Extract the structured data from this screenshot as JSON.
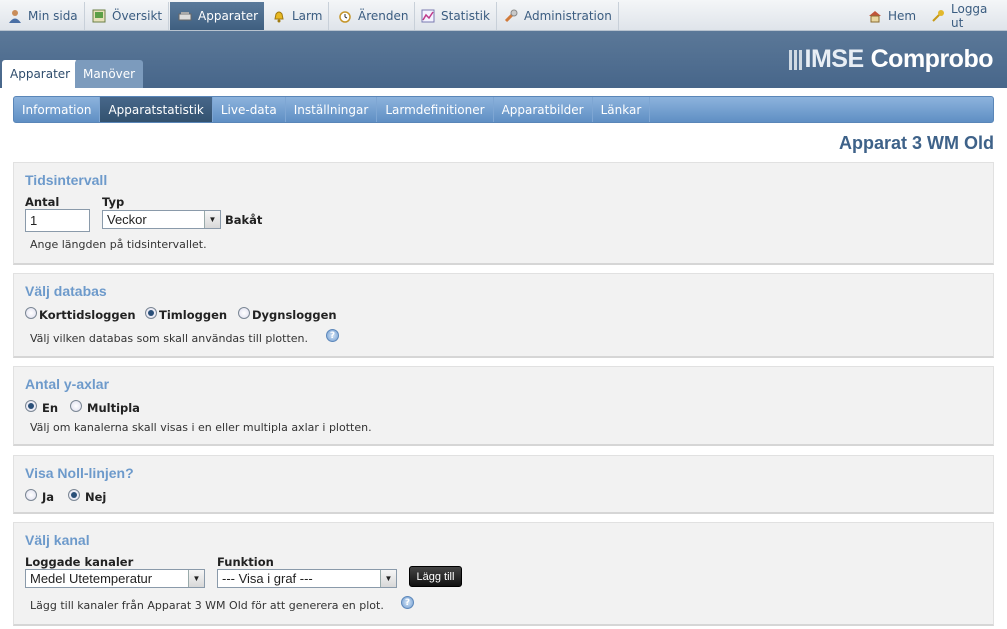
{
  "nav": {
    "items": [
      {
        "label": "Min sida",
        "icon": "user-icon"
      },
      {
        "label": "Översikt",
        "icon": "overview-icon"
      },
      {
        "label": "Apparater",
        "icon": "device-icon"
      },
      {
        "label": "Larm",
        "icon": "alarm-bell-icon"
      },
      {
        "label": "Ärenden",
        "icon": "alarm-clock-icon"
      },
      {
        "label": "Statistik",
        "icon": "chart-icon"
      },
      {
        "label": "Administration",
        "icon": "wrench-icon"
      }
    ],
    "home": "Hem",
    "logout": "Logga ut"
  },
  "logo": {
    "imse": "IMSE",
    "product": "Comprobo"
  },
  "section_tabs": [
    "Apparater",
    "Manöver"
  ],
  "sub_tabs": [
    "Information",
    "Apparatstatistik",
    "Live-data",
    "Inställningar",
    "Larmdefinitioner",
    "Apparatbilder",
    "Länkar"
  ],
  "page_title": "Apparat 3 WM Old",
  "tidsintervall": {
    "heading": "Tidsintervall",
    "antal_label": "Antal",
    "antal_value": "1",
    "typ_label": "Typ",
    "typ_value": "Veckor",
    "suffix": "Bakåt",
    "hint": "Ange längden på tidsintervallet."
  },
  "databas": {
    "heading": "Välj databas",
    "options": [
      "Korttidsloggen",
      "Timloggen",
      "Dygnsloggen"
    ],
    "selected": "Timloggen",
    "hint": "Välj vilken databas som skall användas till plotten."
  },
  "yaxlar": {
    "heading": "Antal y-axlar",
    "options": [
      "En",
      "Multipla"
    ],
    "selected": "En",
    "hint": "Välj om kanalerna skall visas i en eller multipla axlar i plotten."
  },
  "noll": {
    "heading": "Visa Noll-linjen?",
    "options": [
      "Ja",
      "Nej"
    ],
    "selected": "Nej"
  },
  "kanal": {
    "heading": "Välj kanal",
    "loggade_label": "Loggade kanaler",
    "loggade_value": "Medel Utetemperatur",
    "funktion_label": "Funktion",
    "funktion_value": "--- Visa i graf ---",
    "add_button": "Lägg till",
    "hint": "Lägg till kanaler från Apparat 3 WM Old för att generera en plot."
  }
}
